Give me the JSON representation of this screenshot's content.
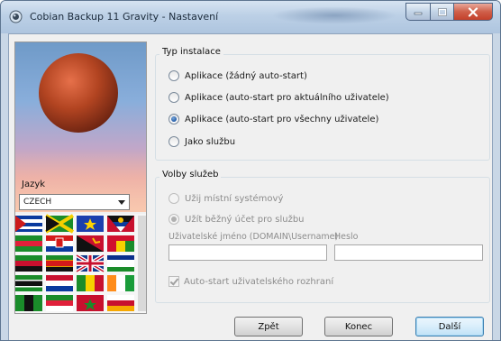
{
  "window": {
    "title": "Cobian Backup 11 Gravity - Nastavení",
    "accent_color": "#3c7fb1"
  },
  "icons": {
    "app": "app-icon",
    "minimize": "minimize-icon",
    "maximize": "maximize-icon",
    "close": "close-icon",
    "dropdown": "chevron-down-icon"
  },
  "language": {
    "label": "Jazyk",
    "selected": "CZECH"
  },
  "install_type": {
    "title": "Typ instalace",
    "options": [
      {
        "label": "Aplikace (žádný auto-start)",
        "checked": false
      },
      {
        "label": "Aplikace (auto-start pro aktuálního uživatele)",
        "checked": false
      },
      {
        "label": "Aplikace (auto-start pro všechny uživatele)",
        "checked": true
      },
      {
        "label": "Jako službu",
        "checked": false
      }
    ]
  },
  "service": {
    "title": "Volby služeb",
    "options": [
      {
        "label": "Užij místní systémový",
        "checked": false
      },
      {
        "label": "Užít běžný účet pro službu",
        "checked": true
      }
    ],
    "username_label": "Uživatelské jméno (DOMAIN\\Username)",
    "username_value": "",
    "password_label": "Heslo",
    "password_value": "",
    "autostart_ui_label": "Auto-start uživatelského rozhraní",
    "autostart_ui_checked": true
  },
  "buttons": {
    "back": "Zpět",
    "end": "Konec",
    "next": "Další"
  }
}
